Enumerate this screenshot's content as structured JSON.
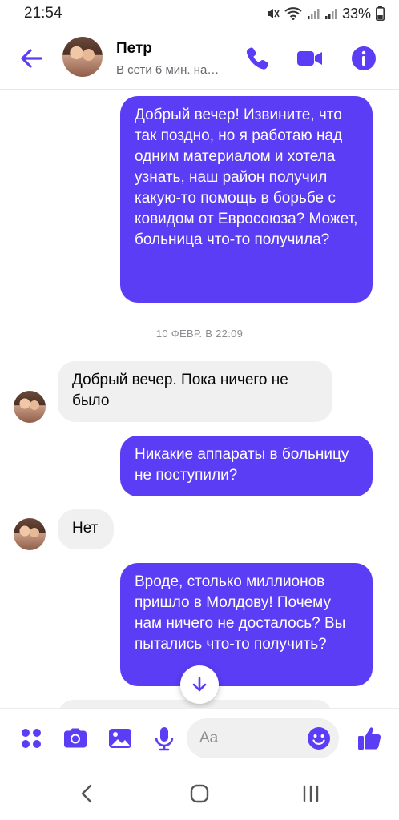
{
  "status_bar": {
    "time": "21:54",
    "battery": "33%"
  },
  "header": {
    "contact_name": "Петр",
    "contact_status": "В сети 6 мин. на…"
  },
  "messages": [
    {
      "direction": "out",
      "text": "Добрый вечер! Извините, что так поздно, но я работаю над одним материалом и хотела узнать, наш район получил какую-то помощь в борьбе с ковидом от Евросоюза? Может, больница что-то получила?"
    },
    {
      "type": "timestamp",
      "text": "10 ФЕВР. В 22:09"
    },
    {
      "direction": "in",
      "text": "Добрый вечер. Пока ничего не было"
    },
    {
      "direction": "out",
      "text": "Никакие аппараты в больницу не поступили?"
    },
    {
      "direction": "in",
      "text": "Нет"
    },
    {
      "direction": "out",
      "text": "Вроде, столько миллионов пришло в Молдову! Почему нам ничего не досталось? Вы пытались что-то получить?"
    }
  ],
  "composer": {
    "placeholder": "Aa"
  },
  "colors": {
    "accent": "#5b3df5",
    "incoming_bubble": "#f0f0f0",
    "timestamp_text": "#8a8d91"
  },
  "icons": {
    "header": [
      "back-arrow-icon",
      "phone-icon",
      "video-camera-icon",
      "info-icon"
    ],
    "composer": [
      "apps-icon",
      "camera-icon",
      "gallery-icon",
      "microphone-icon",
      "emoji-icon",
      "thumbs-up-icon"
    ],
    "nav": [
      "nav-back-icon",
      "nav-home-icon",
      "nav-recents-icon"
    ]
  }
}
